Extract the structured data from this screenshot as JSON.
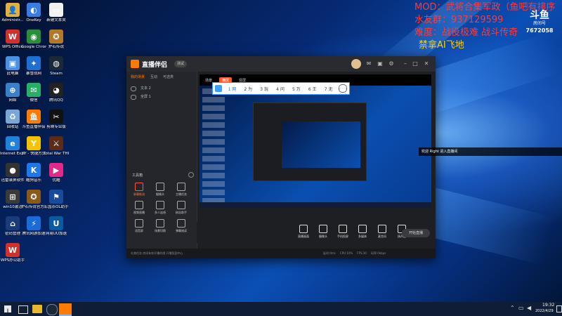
{
  "overlay": {
    "mod_line": "MOD：武将合集军政（鱼吧有排序",
    "fans_line": "水友群：937129599",
    "difficulty_line": "难度：战役极难 战斗传奇",
    "ban_line": "禁拿AI飞地",
    "logo_top": "斗鱼",
    "logo_sub": "房间号",
    "room_number": "7672058"
  },
  "desktop_icons": [
    {
      "label": "Administr...",
      "color": "#e0b040",
      "glyph": "👤",
      "icon": "user-folder-icon"
    },
    {
      "label": "OneKey",
      "color": "#3a7de0",
      "glyph": "◐",
      "icon": "onekey-icon"
    },
    {
      "label": "新建文本夹",
      "color": "#f1f1f1",
      "glyph": "▭",
      "icon": "text-file-icon"
    },
    {
      "label": "WPS Office",
      "color": "#d0312d",
      "glyph": "W",
      "icon": "wps-office-icon"
    },
    {
      "label": "Google Chrome",
      "color": "#2a8c3c",
      "glyph": "◉",
      "icon": "chrome-icon"
    },
    {
      "label": "炉石传说",
      "color": "#b07a2a",
      "glyph": "✪",
      "icon": "hearthstone-icon"
    },
    {
      "label": "此电脑",
      "color": "#4a90e2",
      "glyph": "▣",
      "icon": "this-pc-icon"
    },
    {
      "label": "暴雪战网",
      "color": "#1f6fd1",
      "glyph": "✦",
      "icon": "battlenet-icon"
    },
    {
      "label": "Steam",
      "color": "#1b2838",
      "glyph": "◍",
      "icon": "steam-icon"
    },
    {
      "label": "网络",
      "color": "#3a80c8",
      "glyph": "⊕",
      "icon": "network-icon"
    },
    {
      "label": "微信",
      "color": "#2aae67",
      "glyph": "✉",
      "icon": "wechat-icon"
    },
    {
      "label": "腾讯QQ",
      "color": "#222",
      "glyph": "◕",
      "icon": "qq-icon"
    },
    {
      "label": "回收站",
      "color": "#7aa6d8",
      "glyph": "♻",
      "icon": "recycle-bin-icon"
    },
    {
      "label": "斗鱼直播伴侣",
      "color": "#ff7a00",
      "glyph": "鱼",
      "icon": "douyu-icon"
    },
    {
      "label": "剪映专业版",
      "color": "#111",
      "glyph": "✂",
      "icon": "capcut-icon"
    },
    {
      "label": "Internet Explorer",
      "color": "#1f82d8",
      "glyph": "e",
      "icon": "ie-icon"
    },
    {
      "label": "YY - 快捷方式",
      "color": "#f5c400",
      "glyph": "Y",
      "icon": "yy-icon"
    },
    {
      "label": "Total War THREE KI...",
      "color": "#5a2a1a",
      "glyph": "⚔",
      "icon": "total-war-icon"
    },
    {
      "label": "迅雷录屏软件",
      "color": "#333",
      "glyph": "●",
      "icon": "recorder-icon"
    },
    {
      "label": "酷狗音乐",
      "color": "#1f77e8",
      "glyph": "K",
      "icon": "kugou-icon"
    },
    {
      "label": "优酷",
      "color": "#e02a8a",
      "glyph": "▶",
      "icon": "youku-icon"
    },
    {
      "label": "win10激活",
      "color": "#3a3a3a",
      "glyph": "⊞",
      "icon": "win10-activator-icon"
    },
    {
      "label": "炉石传说官方插件",
      "color": "#8a5a1a",
      "glyph": "✪",
      "icon": "hearthstone-plugin-icon"
    },
    {
      "label": "三国杀OL助手",
      "color": "#1a4a9a",
      "glyph": "⚑",
      "icon": "sgs-helper-icon"
    },
    {
      "label": "密码管理",
      "color": "#1a3a7a",
      "glyph": "⌂",
      "icon": "password-manager-icon"
    },
    {
      "label": "腾讯网游加速",
      "color": "#1a6ad8",
      "glyph": "⚡",
      "icon": "tencent-accel-icon"
    },
    {
      "label": "网易UU加速",
      "color": "#0a5aa0",
      "glyph": "U",
      "icon": "uu-accel-icon"
    },
    {
      "label": "WPS办公助手",
      "color": "#d0312d",
      "glyph": "W",
      "icon": "wps-assistant-icon"
    }
  ],
  "app": {
    "name": "直播伴侣",
    "version_badge": "测试",
    "left_tabs": [
      "我的场景",
      "互动",
      "可选类"
    ],
    "scenes": [
      "文本 2",
      "全屏 1"
    ],
    "tools_header": "工具箱",
    "tools": [
      "屏幕推流",
      "摄像头",
      "主播任务",
      "视频直播",
      "多人连线",
      "粉丝助手",
      "语音屏",
      "场景切换",
      "弹幕阅读"
    ],
    "preview_tabs": [
      "场景",
      "横屏",
      "竖屏"
    ],
    "ctrl_buttons": [
      "直播画面",
      "摄像头",
      "手机投屏",
      "多媒体",
      "麦克风",
      "扬声器"
    ],
    "start_button": "开始直播",
    "status_text": "礼物任务  房间有你开播的哦 开播奖励中心",
    "status_stats": [
      "延时:0ms",
      "CPU:10%",
      "FPS:30",
      "码率:0kbps"
    ]
  },
  "ime": {
    "candidates": [
      "1 网",
      "2 为",
      "3 玩",
      "4 问",
      "5 万",
      "6 王",
      "7 无"
    ]
  },
  "chat_notice": "欢迎 Right 进入直播间",
  "taskbar": {
    "time": "19:32",
    "date": "2022/4/29"
  }
}
